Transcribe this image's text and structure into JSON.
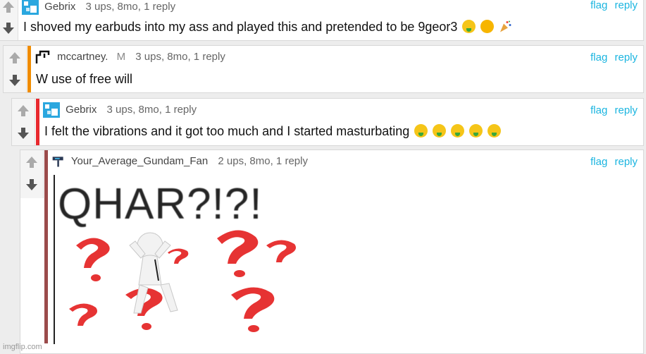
{
  "comments": [
    {
      "user": "Gebrix",
      "badge": "",
      "stats": "3 ups, 8mo, 1 reply",
      "text": "I shoved my earbuds into my ass and played this and pretended to be 9geor3",
      "emojis": [
        "money-mouth-face-icon",
        "rolling-laughing-face-icon",
        "party-popper-icon"
      ],
      "stripe_color": ""
    },
    {
      "user": "mccartney.",
      "badge": "M",
      "stats": "3 ups, 8mo, 1 reply",
      "text": "W use of free will",
      "emojis": [],
      "stripe_color": "#f08c00"
    },
    {
      "user": "Gebrix",
      "badge": "",
      "stats": "3 ups, 8mo, 1 reply",
      "text": "I felt the vibrations and it got too much and I started masturbating",
      "emojis": [
        "money-mouth-face-icon",
        "money-mouth-face-icon",
        "money-mouth-face-icon",
        "money-mouth-face-icon",
        "money-mouth-face-icon"
      ],
      "stripe_color": "#e8282d"
    },
    {
      "user": "Your_Average_Gundam_Fan",
      "badge": "",
      "stats": "2 ups, 8mo, 1 reply",
      "text": "",
      "emojis": [],
      "stripe_color": "#9b4b4b"
    }
  ],
  "actions": {
    "flag": "flag",
    "reply": "reply"
  },
  "image_meme": {
    "caption": "QHAR?!?!"
  },
  "watermark": "imgflip.com",
  "colors": {
    "link": "#1bb5e0",
    "background": "#ededed"
  }
}
